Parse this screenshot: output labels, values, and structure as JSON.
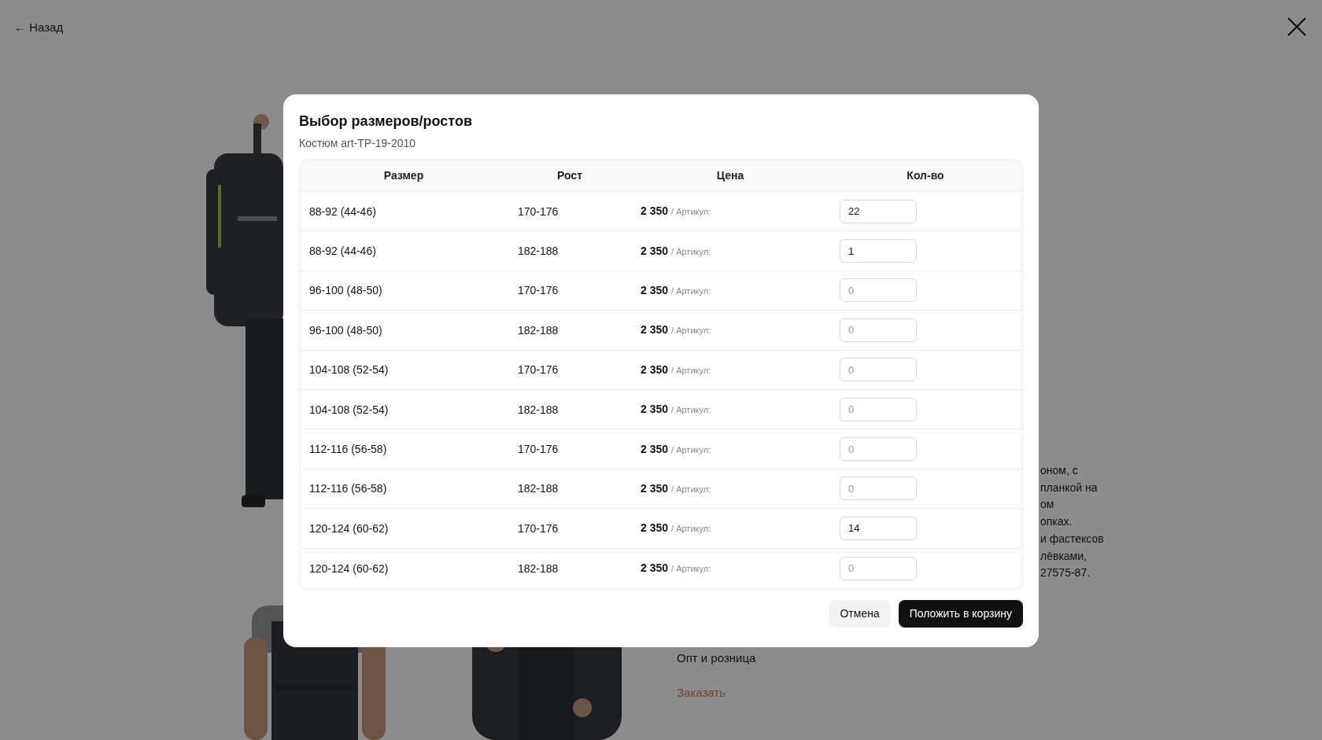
{
  "page": {
    "back_link": "← Назад",
    "description_fragments": [
      "оном, с",
      "планкой на",
      "ом",
      "опках.",
      "и фастексов",
      "лёвками,",
      "27575-87."
    ],
    "sale_note": "Опт и розница",
    "order_link": "Заказать"
  },
  "modal": {
    "title": "Выбор размеров/ростов",
    "subtitle": "Костюм art-TP-19-2010",
    "columns": [
      "Размер",
      "Рост",
      "Цена",
      "Кол-во"
    ],
    "rows": [
      {
        "size": "88-92 (44-46)",
        "height": "170-176",
        "price": "2 350",
        "article": "/ Артикул:",
        "quantity": "22"
      },
      {
        "size": "88-92 (44-46)",
        "height": "182-188",
        "price": "2 350",
        "article": "/ Артикул:",
        "quantity": "1"
      },
      {
        "size": "96-100 (48-50)",
        "height": "170-176",
        "price": "2 350",
        "article": "/ Артикул:",
        "placeholder": "0"
      },
      {
        "size": "96-100 (48-50)",
        "height": "182-188",
        "price": "2 350",
        "article": "/ Артикул:",
        "placeholder": "0"
      },
      {
        "size": "104-108 (52-54)",
        "height": "170-176",
        "price": "2 350",
        "article": "/ Артикул:",
        "placeholder": "0"
      },
      {
        "size": "104-108 (52-54)",
        "height": "182-188",
        "price": "2 350",
        "article": "/ Артикул:",
        "placeholder": "0"
      },
      {
        "size": "112-116 (56-58)",
        "height": "170-176",
        "price": "2 350",
        "article": "/ Артикул:",
        "placeholder": "0"
      },
      {
        "size": "112-116 (56-58)",
        "height": "182-188",
        "price": "2 350",
        "article": "/ Артикул:",
        "placeholder": "0"
      },
      {
        "size": "120-124 (60-62)",
        "height": "170-176",
        "price": "2 350",
        "article": "/ Артикул:",
        "quantity": "14"
      },
      {
        "size": "120-124 (60-62)",
        "height": "182-188",
        "price": "2 350",
        "article": "/ Артикул:",
        "placeholder": "0"
      }
    ],
    "cancel_button": "Отмена",
    "submit_button": "Положить в корзину"
  }
}
